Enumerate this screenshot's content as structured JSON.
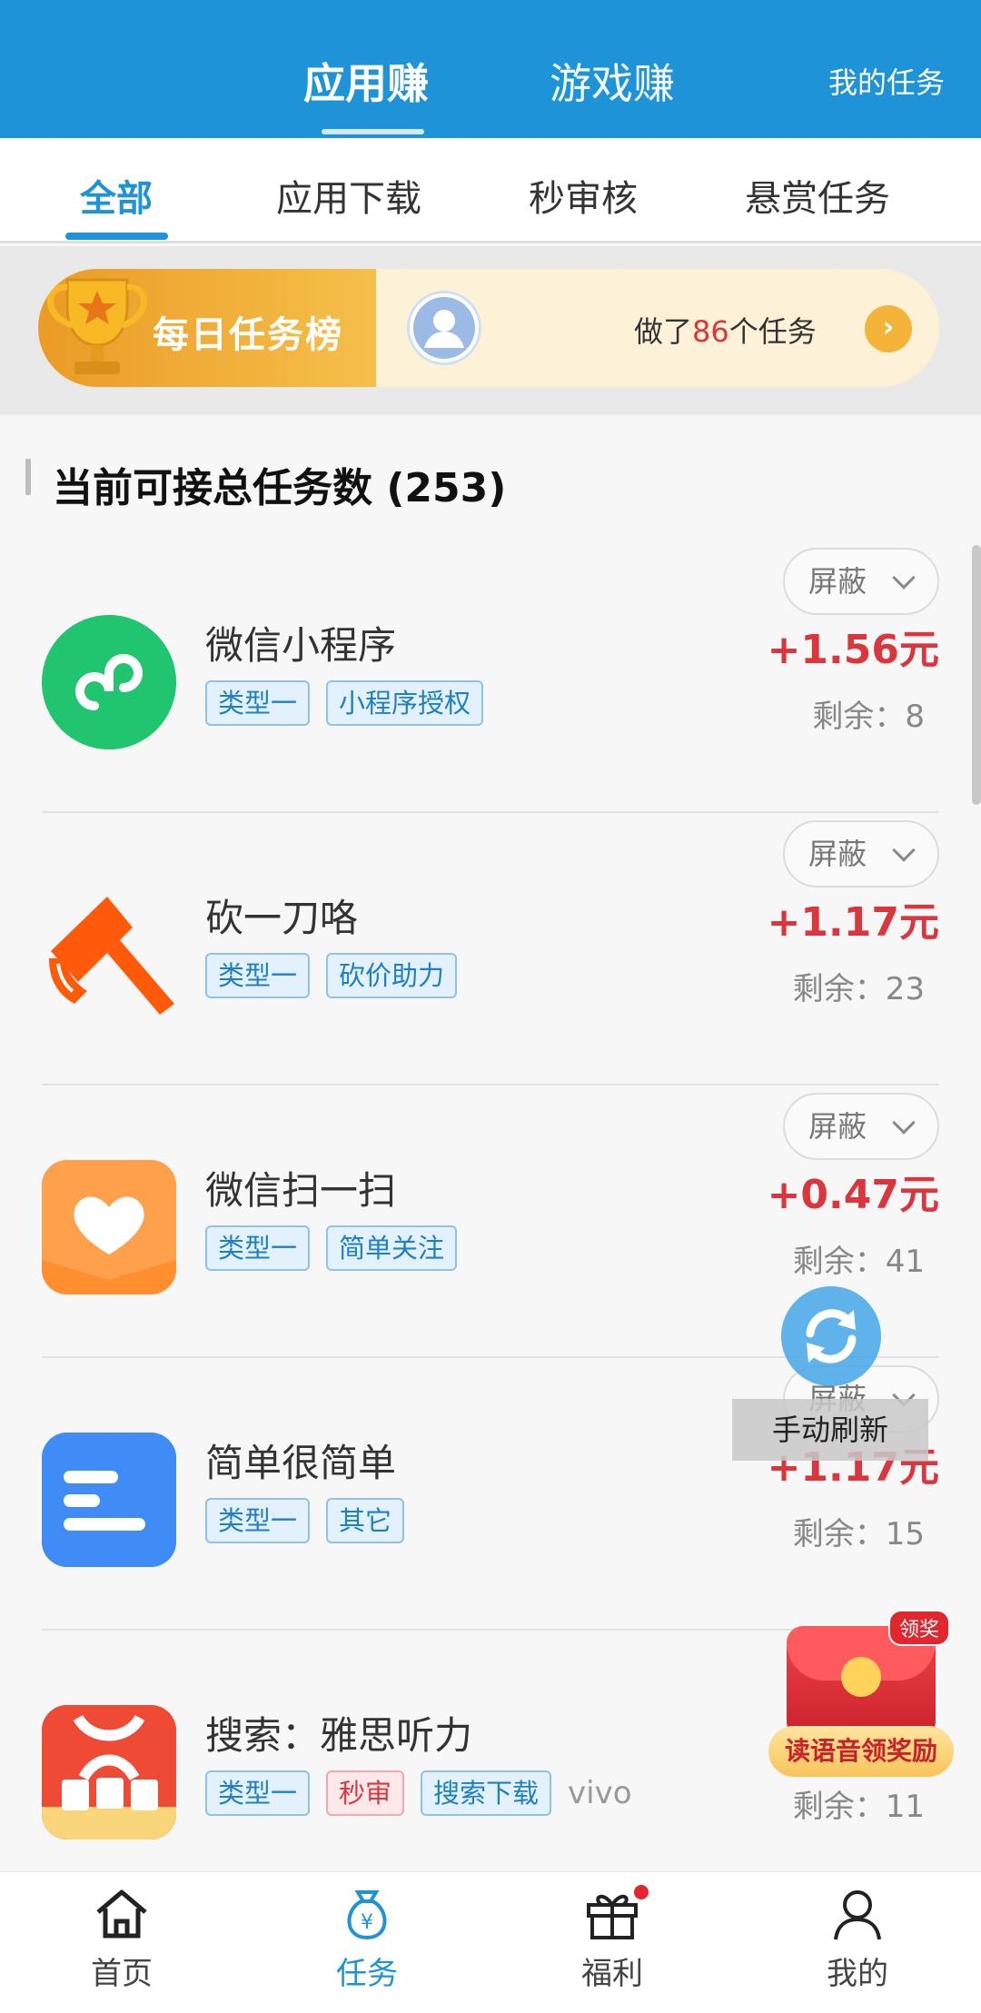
{
  "header": {
    "tabs": [
      {
        "label": "应用赚",
        "active": true
      },
      {
        "label": "游戏赚",
        "active": false
      }
    ],
    "my_tasks": "我的任务"
  },
  "subtabs": [
    {
      "label": "全部",
      "active": true
    },
    {
      "label": "应用下载",
      "active": false
    },
    {
      "label": "秒审核",
      "active": false
    },
    {
      "label": "悬赏任务",
      "active": false
    }
  ],
  "banner": {
    "title": "每日任务榜",
    "text_prefix": "做了",
    "count": "86",
    "text_suffix": "个任务"
  },
  "section_title": "当前可接总任务数 (253)",
  "block_label": "屏蔽",
  "tasks": [
    {
      "name": "微信小程序",
      "tags": [
        {
          "text": "类型一",
          "style": "blue"
        },
        {
          "text": "小程序授权",
          "style": "blue"
        }
      ],
      "platform": "",
      "price": "+1.56元",
      "remain": "剩余：8",
      "icon": "wechat-miniprogram-icon"
    },
    {
      "name": "砍一刀咯",
      "tags": [
        {
          "text": "类型一",
          "style": "blue"
        },
        {
          "text": "砍价助力",
          "style": "blue"
        }
      ],
      "platform": "",
      "price": "+1.17元",
      "remain": "剩余：23",
      "icon": "axe-icon"
    },
    {
      "name": "微信扫一扫",
      "tags": [
        {
          "text": "类型一",
          "style": "blue"
        },
        {
          "text": "简单关注",
          "style": "blue"
        }
      ],
      "platform": "",
      "price": "+0.47元",
      "remain": "剩余：41",
      "icon": "heart-ribbon-icon"
    },
    {
      "name": "简单很简单",
      "tags": [
        {
          "text": "类型一",
          "style": "blue"
        },
        {
          "text": "其它",
          "style": "blue"
        }
      ],
      "platform": "",
      "price": "+1.17元",
      "remain": "剩余：15",
      "icon": "text-lines-icon"
    },
    {
      "name": "搜索：雅思听力",
      "tags": [
        {
          "text": "类型一",
          "style": "blue"
        },
        {
          "text": "秒审",
          "style": "red"
        },
        {
          "text": "搜索下载",
          "style": "blue"
        }
      ],
      "platform": "vivo",
      "price": "",
      "remain": "剩余：11",
      "icon": "ielts-app-icon"
    }
  ],
  "refresh_label": "手动刷新",
  "reward": {
    "badge": "领奖",
    "label": "读语音领奖励"
  },
  "bottom_nav": [
    {
      "label": "首页",
      "icon": "home-icon",
      "active": false
    },
    {
      "label": "任务",
      "icon": "money-bag-icon",
      "active": true
    },
    {
      "label": "福利",
      "icon": "gift-icon",
      "active": false,
      "dot": true
    },
    {
      "label": "我的",
      "icon": "user-icon",
      "active": false
    }
  ],
  "colors": {
    "brand": "#1e93d8",
    "price": "#d9363e",
    "banner_gold": "#f5c04a"
  }
}
